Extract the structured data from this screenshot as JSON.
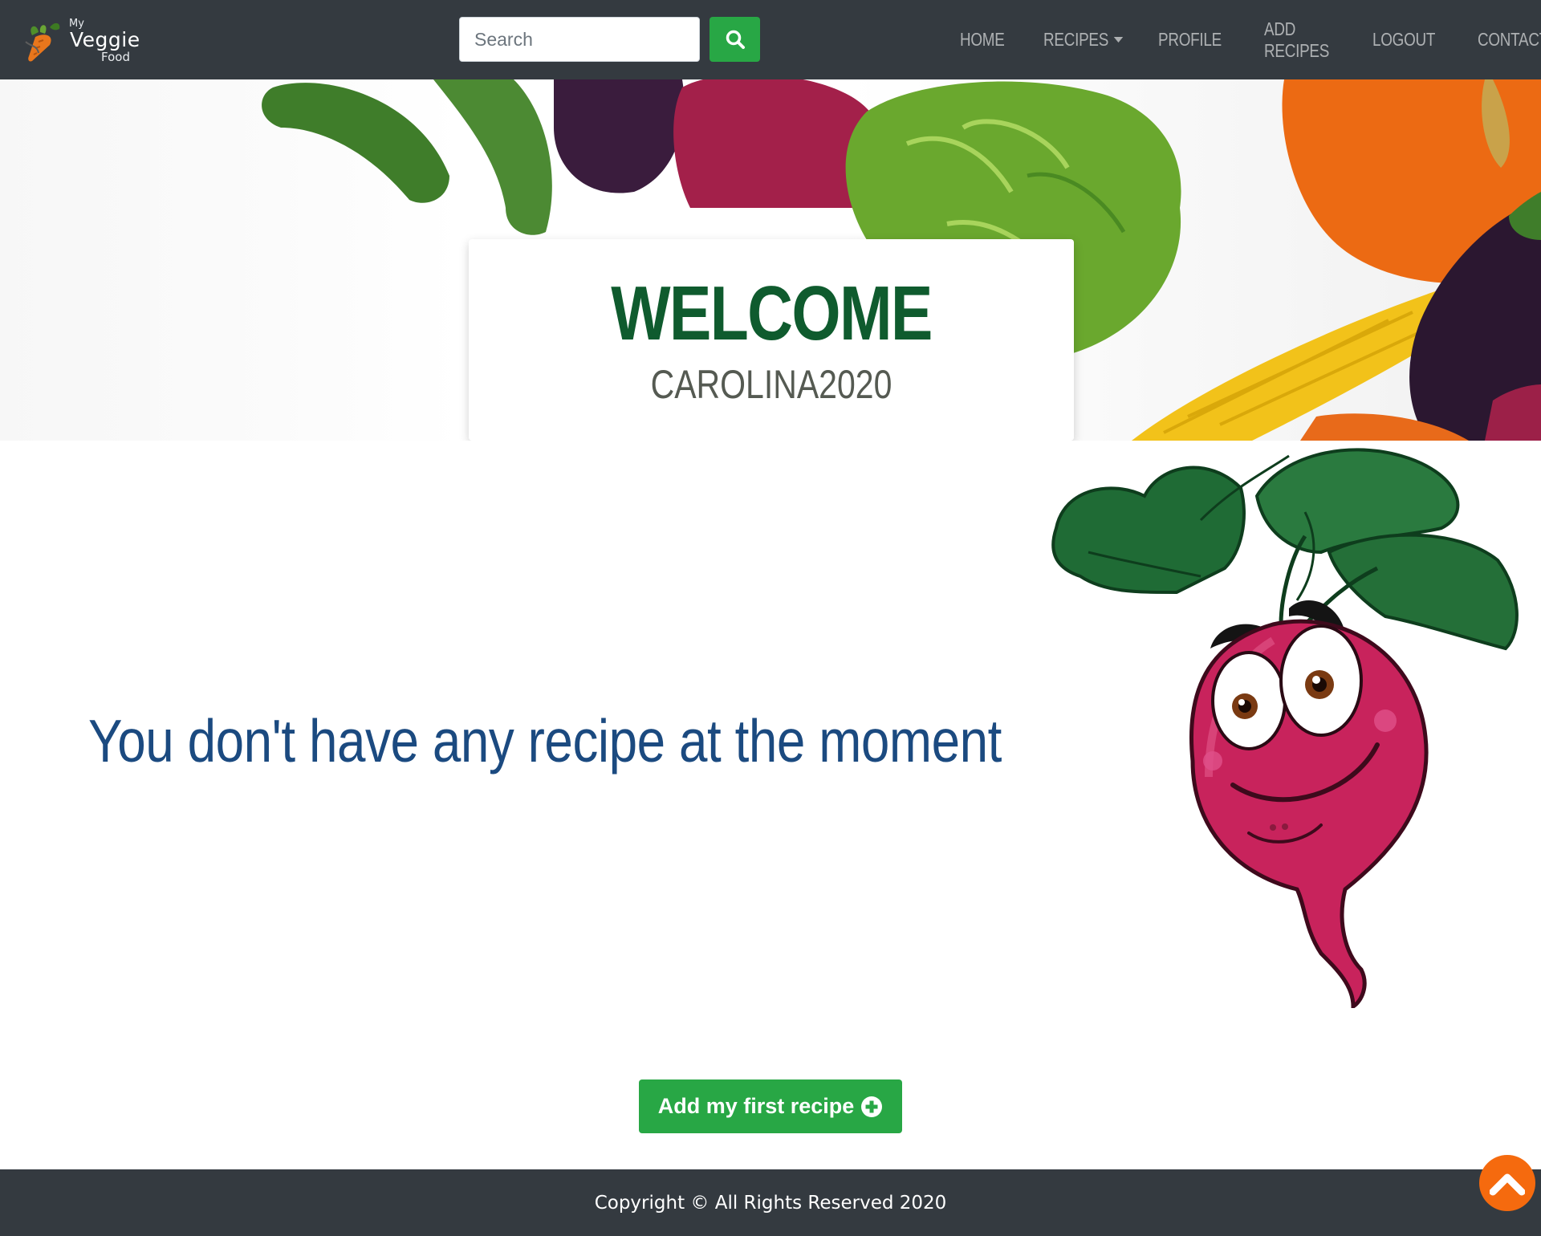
{
  "brand": {
    "line1": "My",
    "line2": "Veggie",
    "line3": "Food"
  },
  "search": {
    "placeholder": "Search"
  },
  "nav": {
    "items": [
      {
        "label": "HOME"
      },
      {
        "label": "RECIPES"
      },
      {
        "label": "PROFILE"
      },
      {
        "label": "ADD RECIPES"
      },
      {
        "label": "LOGOUT"
      },
      {
        "label": "CONTACT"
      }
    ]
  },
  "hero": {
    "title": "WELCOME",
    "username": "CAROLINA2020"
  },
  "main": {
    "empty_message": "You don't have any recipe at the moment",
    "add_button_label": "Add my first recipe"
  },
  "footer": {
    "copyright": "Copyright © All Rights Reserved 2020"
  },
  "colors": {
    "navbar": "#343a40",
    "primary_green": "#28a745",
    "welcome_green": "#0f5b2e",
    "message_blue": "#1b4a80",
    "scroll_orange": "#f56a0e"
  },
  "icons": {
    "search": "search-icon",
    "add": "plus-circle-icon",
    "scroll_top": "chevron-up-icon",
    "dropdown": "caret-down-icon"
  }
}
